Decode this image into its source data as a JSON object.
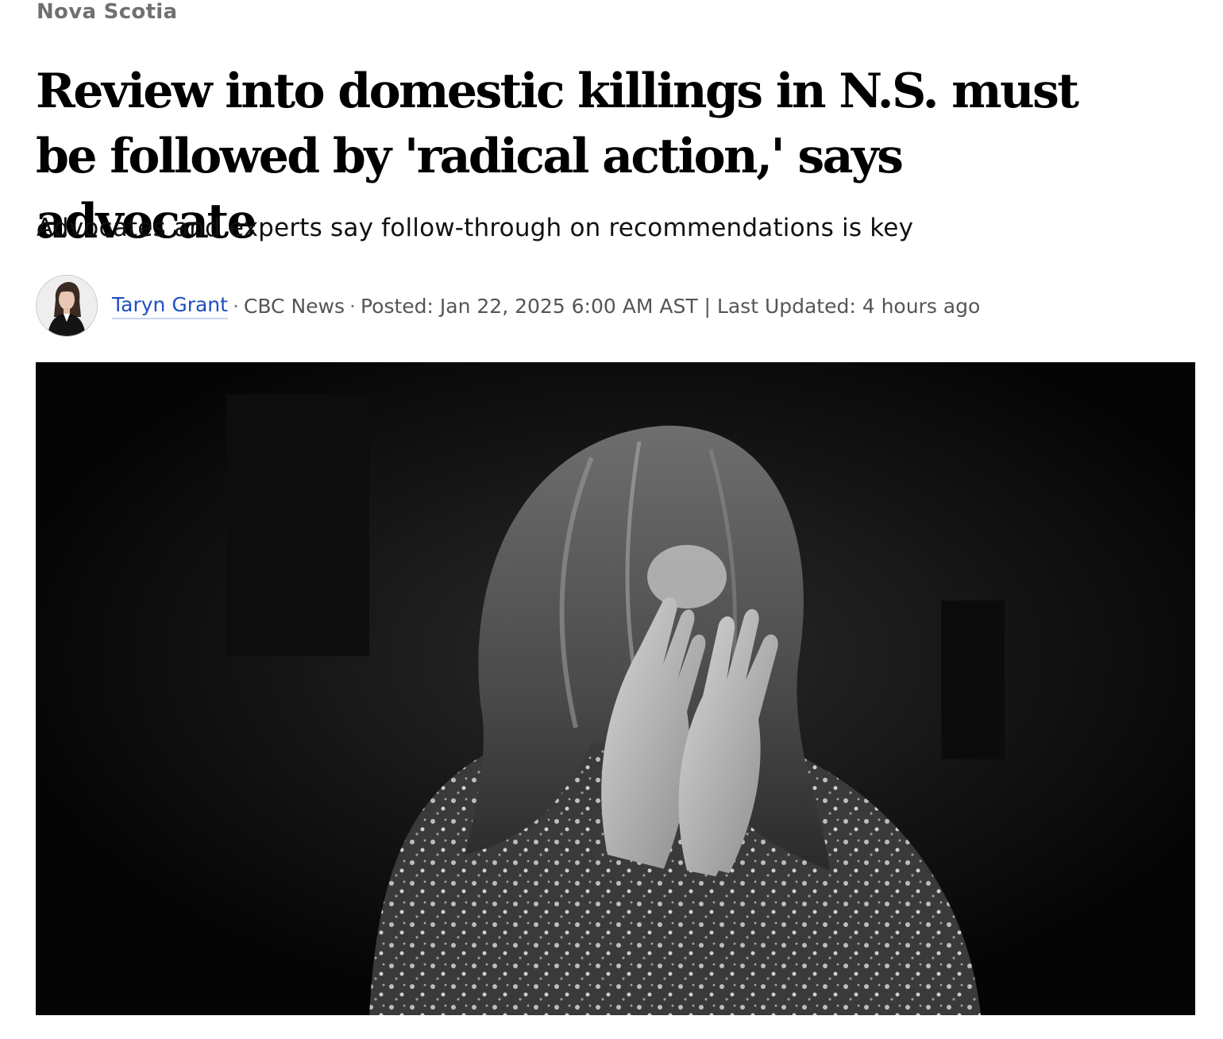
{
  "section": {
    "label": "Nova Scotia"
  },
  "article": {
    "headline": "Review into domestic killings in N.S. must be followed by 'radical action,' says advocate",
    "deck": "Advocates and experts say follow-through on recommendations is key"
  },
  "byline": {
    "author": "Taryn Grant",
    "separator": "·",
    "outlet": "CBC News",
    "posted": "Posted: Jan 22, 2025 6:00 AM AST | Last Updated: 4 hours ago"
  }
}
